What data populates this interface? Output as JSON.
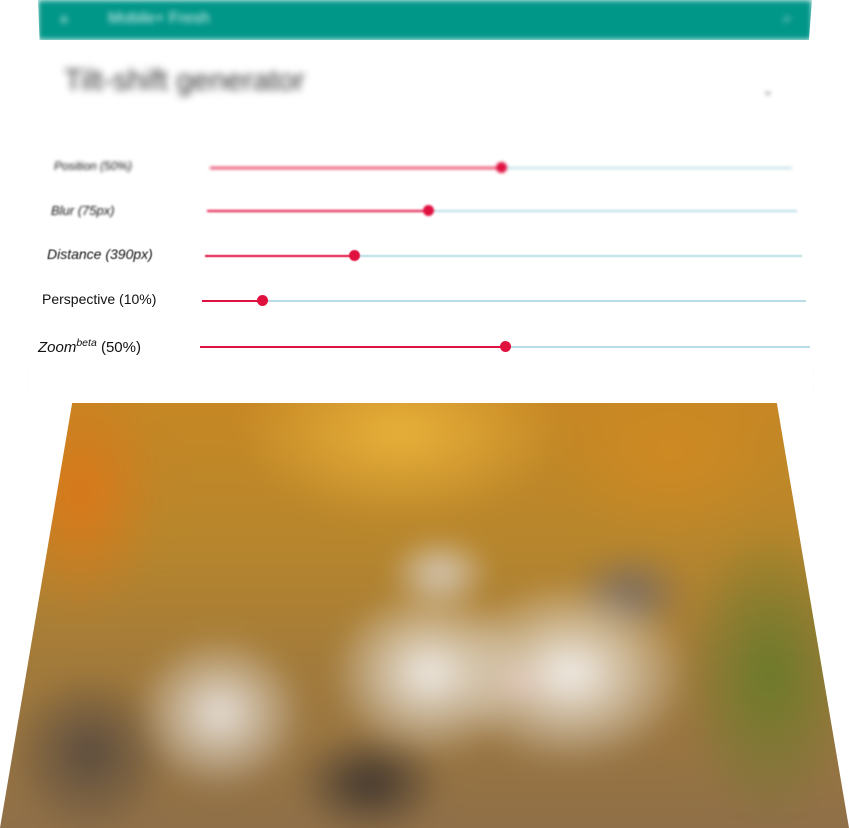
{
  "app_bar": {
    "title": "Mobile+ Fresh",
    "menu_icon": "menu-icon",
    "search_icon": "search-icon",
    "color": "#009688"
  },
  "card": {
    "heading": "Tilt-shift generator",
    "collapse_icon": "chevron-down-icon"
  },
  "sliders": [
    {
      "label": "Position (50%)",
      "value_fraction": 0.5
    },
    {
      "label": "Blur (75px)",
      "value_fraction": 0.375
    },
    {
      "label": "Distance (390px)",
      "value_fraction": 0.25
    },
    {
      "label": "Perspective (10%)",
      "value_fraction": 0.1
    },
    {
      "label_main": "Zoom",
      "label_sup": "beta",
      "label_tail": " (50%)",
      "value_fraction": 0.5
    }
  ],
  "accent_color": "#e0103f",
  "track_color": "#b7dde6",
  "photo": {
    "description_icon": "kittens-photo"
  }
}
